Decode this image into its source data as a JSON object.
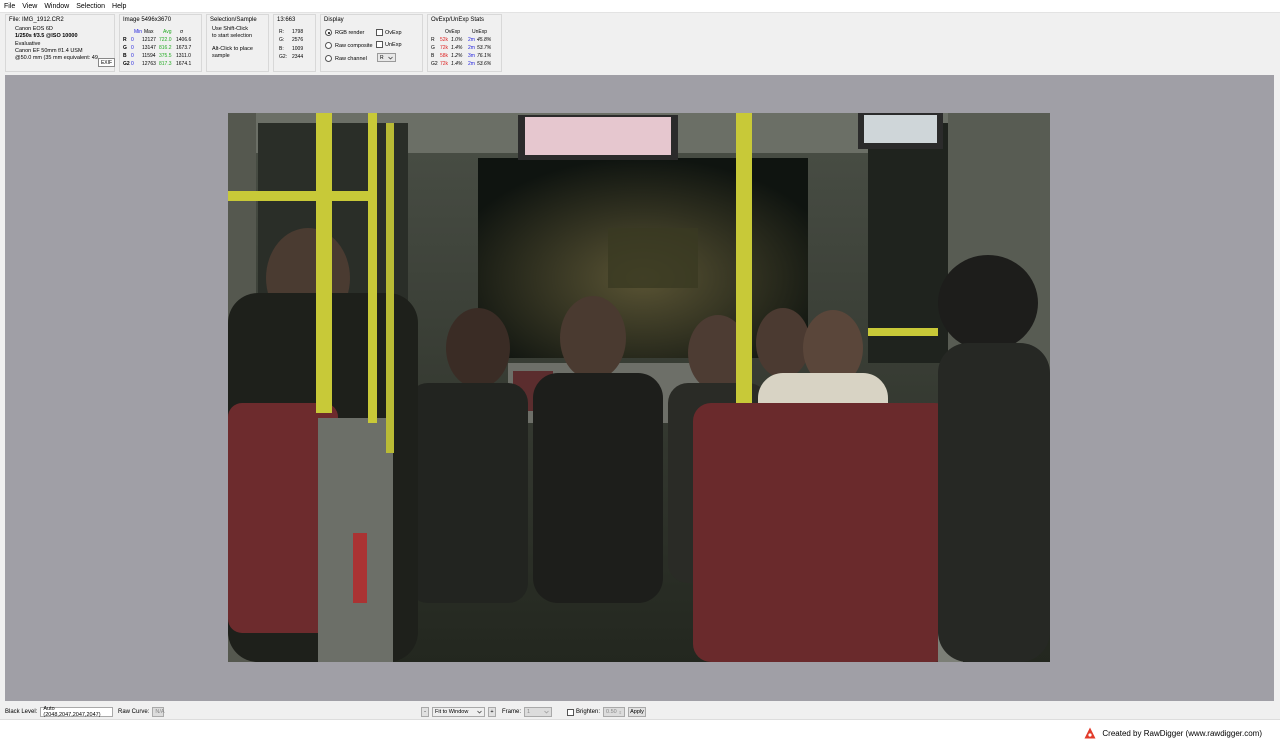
{
  "menu": [
    "File",
    "View",
    "Window",
    "Selection",
    "Help"
  ],
  "file_panel": {
    "title": "File: IMG_1912.CR2",
    "camera": "Canon EOS 6D",
    "exposure": "1/250s f/3.5 @ISO 10000",
    "metering": "Evaluative",
    "lens": "Canon EF 50mm f/1.4 USM",
    "focal": "@50.0 mm (35 mm equivalent: 49.",
    "exif_button": "EXIF"
  },
  "image_panel": {
    "title": "Image 5496x3670",
    "headers": [
      "Min",
      "Max",
      "Avg",
      "σ"
    ],
    "rows": [
      {
        "ch": "R",
        "min": "0",
        "max": "12127",
        "avg": "722.0",
        "sd": "1406.6"
      },
      {
        "ch": "G",
        "min": "0",
        "max": "13147",
        "avg": "816.2",
        "sd": "1673.7"
      },
      {
        "ch": "B",
        "min": "0",
        "max": "11594",
        "avg": "375.5",
        "sd": "1311.0"
      },
      {
        "ch": "G2",
        "min": "0",
        "max": "12763",
        "avg": "817.3",
        "sd": "1674.1"
      }
    ]
  },
  "selection_panel": {
    "title": "Selection/Sample",
    "line1": "Use Shift-Click",
    "line2": "to start selection",
    "line3": "Alt-Click to place",
    "line4": "sample"
  },
  "pixel_panel": {
    "title": "13:663",
    "rows": [
      {
        "label": "R:",
        "value": "1798"
      },
      {
        "label": "G:",
        "value": "2576"
      },
      {
        "label": "B:",
        "value": "1009"
      },
      {
        "label": "G2:",
        "value": "2344"
      }
    ]
  },
  "display_panel": {
    "title": "Display",
    "rgb_render": "RGB render",
    "raw_composite": "Raw composite",
    "raw_channel": "Raw channel",
    "ovexp": "OvExp",
    "unexp": "UnExp",
    "channel_value": "R"
  },
  "ovexp_panel": {
    "title": "OvExp/UnExp Stats",
    "headers": [
      "OvExp",
      "UnExp"
    ],
    "rows": [
      {
        "ch": "R",
        "ov_count": "52k",
        "ov_pct": "1.0%",
        "un_count": "2m",
        "un_pct": "45.8%"
      },
      {
        "ch": "G",
        "ov_count": "72k",
        "ov_pct": "1.4%",
        "un_count": "2m",
        "un_pct": "53.7%"
      },
      {
        "ch": "B",
        "ov_count": "58k",
        "ov_pct": "1.2%",
        "un_count": "3m",
        "un_pct": "76.1%"
      },
      {
        "ch": "G2",
        "ov_count": "72k",
        "ov_pct": "1.4%",
        "un_count": "2m",
        "un_pct": "53.6%"
      }
    ]
  },
  "bottom": {
    "black_level_label": "Black Level:",
    "black_level_value": "Auto (2048,2047,2047,2047)",
    "raw_curve_label": "Raw Curve:",
    "raw_curve_value": "N/A",
    "minus": "-",
    "zoom": "Fit to Window",
    "plus": "+",
    "frame_label": "Frame:",
    "frame_value": "1",
    "brighten_label": "Brighten:",
    "brighten_value": "0.50",
    "apply": "Apply"
  },
  "footer": {
    "credit": "Created by RawDigger (www.rawdigger.com)"
  },
  "colors": {
    "viewport_bg": "#a09fa6",
    "blue": "#2222dd",
    "green": "#22aa22",
    "red": "#dd2222"
  }
}
